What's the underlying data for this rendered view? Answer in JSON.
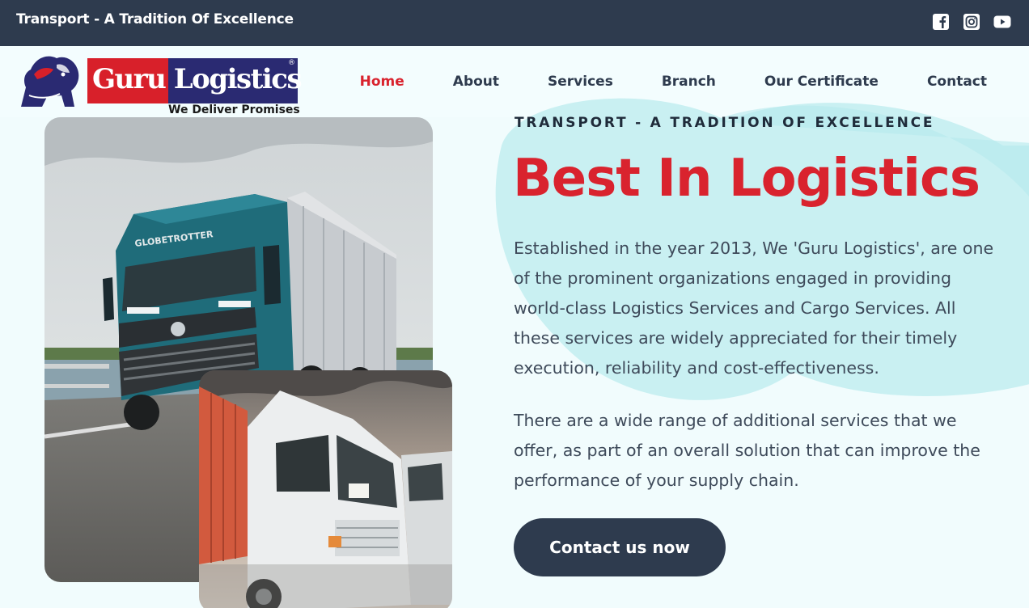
{
  "topbar": {
    "tagline": "Transport - A Tradition Of Excellence",
    "social": [
      "facebook-icon",
      "instagram-icon",
      "youtube-icon"
    ]
  },
  "brand": {
    "name_part1": "Guru",
    "name_part2": "Logistics",
    "registered": "®",
    "slogan": "We Deliver Promises"
  },
  "nav": {
    "items": [
      {
        "label": "Home",
        "active": true
      },
      {
        "label": "About",
        "active": false
      },
      {
        "label": "Services",
        "active": false
      },
      {
        "label": "Branch",
        "active": false
      },
      {
        "label": "Our Certificate",
        "active": false
      },
      {
        "label": "Contact",
        "active": false
      }
    ]
  },
  "hero": {
    "eyebrow": "TRANSPORT - A TRADITION OF EXCELLENCE",
    "headline": "Best In Logistics",
    "paragraph1": "Established in the year 2013, We 'Guru Logistics', are one of the prominent organizations engaged in providing world-class Logistics Services and Cargo Services. All these services are widely appreciated for their timely execution, reliability and cost-effectiveness.",
    "paragraph2": "There are a wide range of additional services that we offer, as part of an overall solution that can improve the performance of your supply chain.",
    "cta_label": "Contact us now",
    "truck_badge": "GLOBETROTTER"
  },
  "colors": {
    "topbar_bg": "#2e3b4e",
    "accent_red": "#d9232e",
    "page_bg": "#f1fcfd",
    "blob": "#c9f0f2"
  }
}
